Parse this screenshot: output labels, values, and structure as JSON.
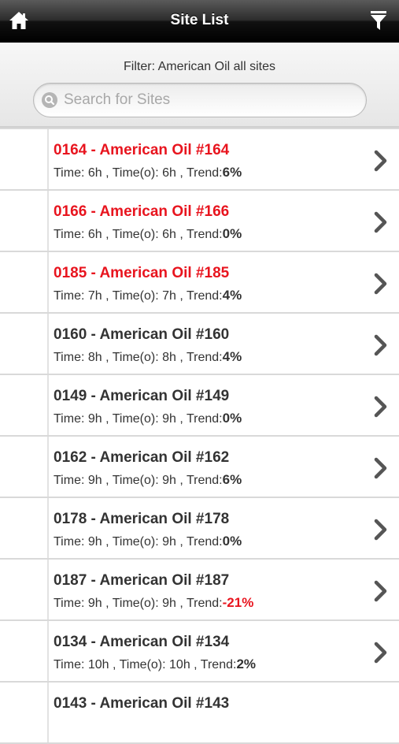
{
  "header": {
    "title": "Site List",
    "home_icon": "home-icon",
    "filter_icon": "funnel-filter-icon"
  },
  "filter": {
    "label": "Filter: American Oil all sites",
    "search_placeholder": "Search for Sites",
    "search_value": ""
  },
  "sites": [
    {
      "name": "0164  -  American Oil #164",
      "time_label": "Time:",
      "time": "6h",
      "timeo_label": "Time(o):",
      "timeo": "6h",
      "trend_label": "Trend:",
      "trend": "6%",
      "alert": true,
      "trend_negative": false
    },
    {
      "name": "0166  -  American Oil #166",
      "time_label": "Time:",
      "time": "6h",
      "timeo_label": "Time(o):",
      "timeo": "6h",
      "trend_label": "Trend:",
      "trend": "0%",
      "alert": true,
      "trend_negative": false
    },
    {
      "name": "0185  -  American Oil #185",
      "time_label": "Time:",
      "time": "7h",
      "timeo_label": "Time(o):",
      "timeo": "7h",
      "trend_label": "Trend:",
      "trend": "4%",
      "alert": true,
      "trend_negative": false
    },
    {
      "name": "0160  -  American Oil #160",
      "time_label": "Time:",
      "time": "8h",
      "timeo_label": "Time(o):",
      "timeo": "8h",
      "trend_label": "Trend:",
      "trend": "4%",
      "alert": false,
      "trend_negative": false
    },
    {
      "name": "0149  -  American Oil #149",
      "time_label": "Time:",
      "time": "9h",
      "timeo_label": "Time(o):",
      "timeo": "9h",
      "trend_label": "Trend:",
      "trend": "0%",
      "alert": false,
      "trend_negative": false
    },
    {
      "name": "0162  -  American Oil #162",
      "time_label": "Time:",
      "time": "9h",
      "timeo_label": "Time(o):",
      "timeo": "9h",
      "trend_label": "Trend:",
      "trend": "6%",
      "alert": false,
      "trend_negative": false
    },
    {
      "name": "0178  -  American Oil #178",
      "time_label": "Time:",
      "time": "9h",
      "timeo_label": "Time(o):",
      "timeo": "9h",
      "trend_label": "Trend:",
      "trend": "0%",
      "alert": false,
      "trend_negative": false
    },
    {
      "name": "0187  -  American Oil #187",
      "time_label": "Time:",
      "time": "9h",
      "timeo_label": "Time(o):",
      "timeo": "9h",
      "trend_label": "Trend:",
      "trend": "-21%",
      "alert": false,
      "trend_negative": true
    },
    {
      "name": "0134  -  American Oil #134",
      "time_label": "Time:",
      "time": "10h",
      "timeo_label": "Time(o):",
      "timeo": "10h",
      "trend_label": "Trend:",
      "trend": "2%",
      "alert": false,
      "trend_negative": false
    },
    {
      "name": "0143  -  American Oil #143",
      "time_label": "",
      "time": "",
      "timeo_label": "",
      "timeo": "",
      "trend_label": "",
      "trend": "",
      "alert": false,
      "trend_negative": false
    }
  ],
  "colors": {
    "alert_red": "#e8141e",
    "text_dark": "#333333",
    "header_black": "#000000"
  }
}
